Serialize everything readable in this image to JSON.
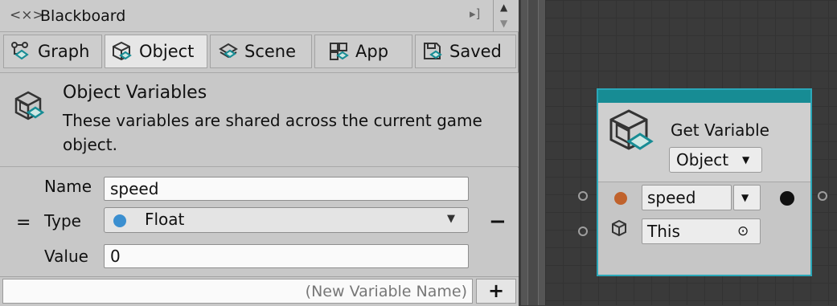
{
  "window": {
    "title": "Blackboard"
  },
  "tabs": [
    {
      "label": "Graph",
      "icon": "graph-icon"
    },
    {
      "label": "Object",
      "icon": "object-icon",
      "active": true
    },
    {
      "label": "Scene",
      "icon": "scene-icon"
    },
    {
      "label": "App",
      "icon": "app-icon"
    },
    {
      "label": "Saved",
      "icon": "saved-icon"
    }
  ],
  "header": {
    "title": "Object Variables",
    "description": "These variables are shared across the current game object."
  },
  "variable": {
    "name_label": "Name",
    "name_value": "speed",
    "type_label": "Type",
    "type_value": "Float",
    "value_label": "Value",
    "value_value": "0",
    "drag_glyph": "=",
    "remove_glyph": "−"
  },
  "new_variable": {
    "placeholder": "(New Variable Name)",
    "add_glyph": "+"
  },
  "node": {
    "title": "Get Variable",
    "kind": "Object",
    "variable_name": "speed",
    "target": "This"
  },
  "colors": {
    "float_port": "#c0622c",
    "float_type": "#3b8fd0",
    "node_accent": "#178c94"
  }
}
